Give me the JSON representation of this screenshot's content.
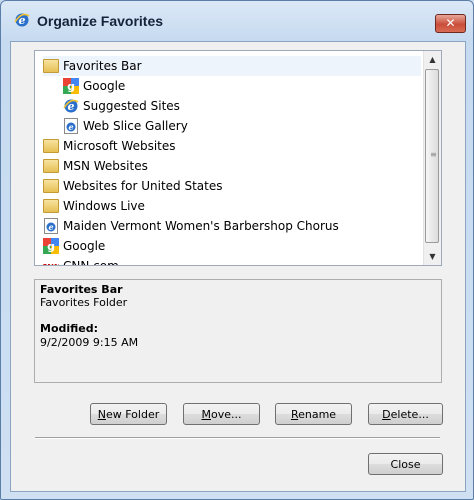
{
  "window": {
    "title": "Organize Favorites",
    "close_glyph": "✕"
  },
  "tree": {
    "items": [
      {
        "label": "Favorites Bar",
        "icon": "folder-icon",
        "indent": 0,
        "selected": true
      },
      {
        "label": "Google",
        "icon": "google-icon",
        "indent": 1
      },
      {
        "label": "Suggested Sites",
        "icon": "suggested-sites-icon",
        "indent": 1
      },
      {
        "label": "Web Slice Gallery",
        "icon": "ie-page-icon",
        "indent": 1
      },
      {
        "label": "Microsoft Websites",
        "icon": "folder-icon",
        "indent": 0
      },
      {
        "label": "MSN Websites",
        "icon": "folder-icon",
        "indent": 0
      },
      {
        "label": "Websites for United States",
        "icon": "folder-icon",
        "indent": 0
      },
      {
        "label": "Windows Live",
        "icon": "folder-icon",
        "indent": 0
      },
      {
        "label": "Maiden Vermont Women's Barbershop Chorus",
        "icon": "ie-page-icon",
        "indent": 0
      },
      {
        "label": "Google",
        "icon": "google-icon",
        "indent": 0
      },
      {
        "label": "CNN.com",
        "icon": "cnn-icon",
        "indent": 0
      }
    ],
    "cnn_logo_text": "CNN"
  },
  "details": {
    "name": "Favorites Bar",
    "type": "Favorites Folder",
    "modified_label": "Modified:",
    "modified_value": "9/2/2009 9:15 AM"
  },
  "buttons": {
    "new_folder_mnemonic": "N",
    "new_folder_rest": "ew Folder",
    "move_mnemonic": "M",
    "move_rest": "ove...",
    "rename_mnemonic": "R",
    "rename_rest": "ename",
    "delete_mnemonic": "D",
    "delete_rest": "elete...",
    "close": "Close"
  },
  "colors": {
    "title_bar": "#c6daf0",
    "close_button": "#c94e3a",
    "folder": "#e6bf54",
    "ie_blue": "#2a6fc9",
    "cnn_red": "#cc0000"
  }
}
